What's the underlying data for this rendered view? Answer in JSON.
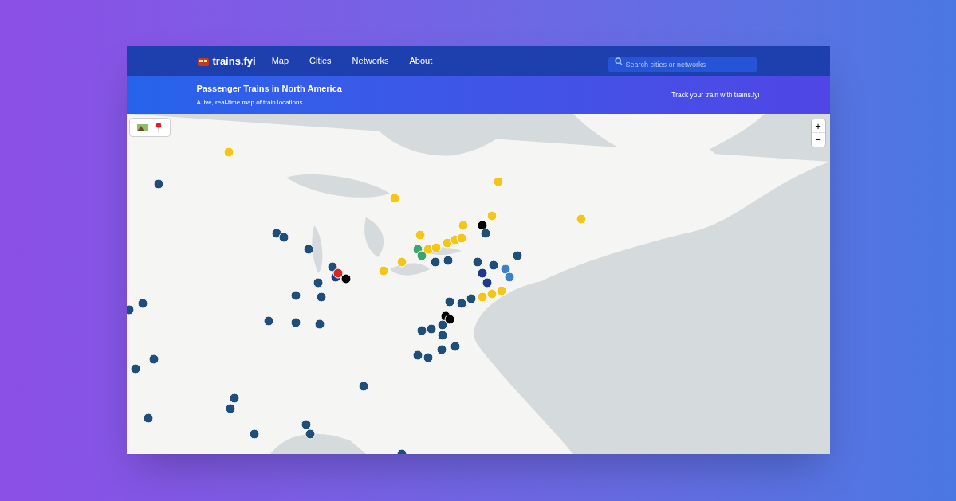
{
  "nav": {
    "brand": "trains.fyi",
    "links": [
      "Map",
      "Cities",
      "Networks",
      "About"
    ],
    "search": {
      "placeholder": "Search cities or networks"
    }
  },
  "banner": {
    "title": "Passenger Trains in North America",
    "subtitle": "A live, real-time map of train locations",
    "link": "Track your train with trains.fyi"
  },
  "map": {
    "kind": "picture",
    "zoom_controls": [
      "+",
      "−"
    ]
  }
}
